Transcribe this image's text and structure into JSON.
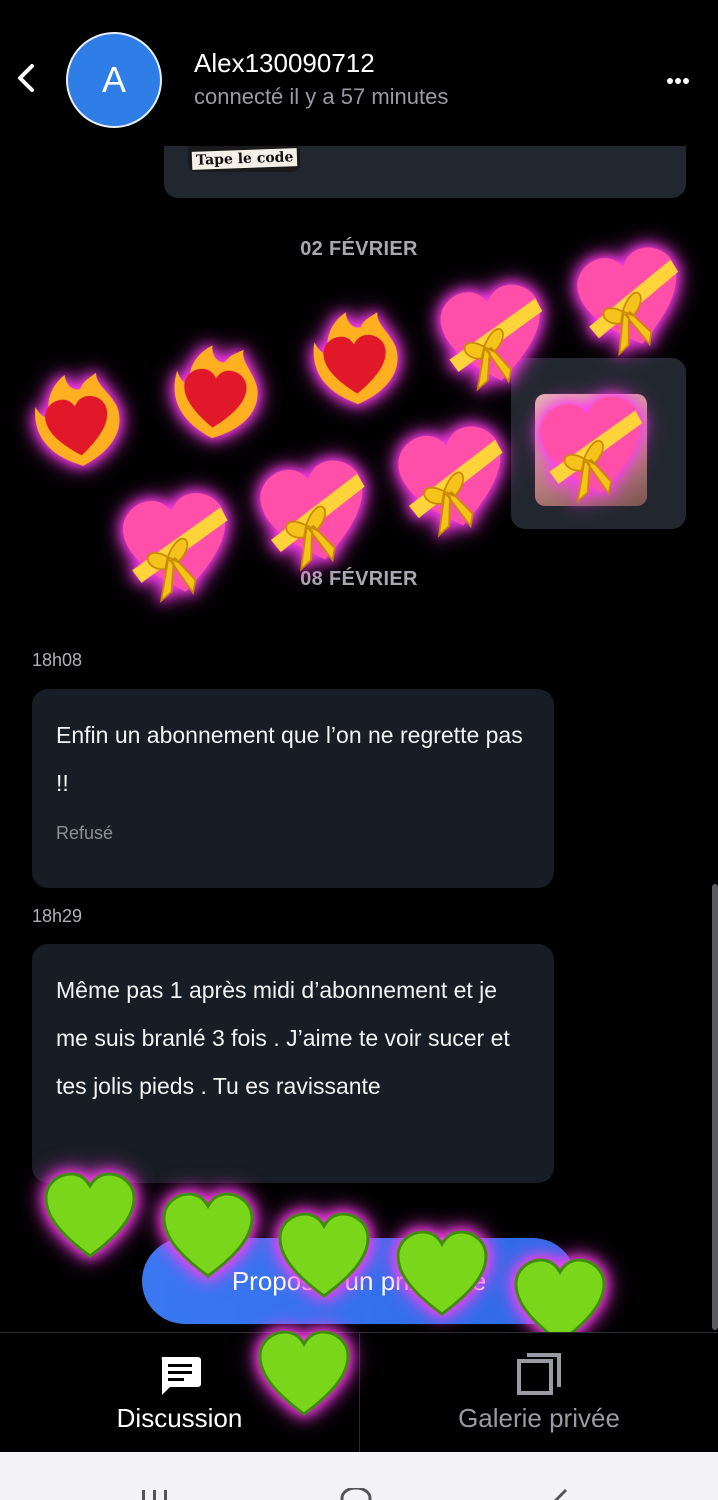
{
  "header": {
    "avatar_letter": "A",
    "contact_name": "Alex130090712",
    "contact_status": "connecté il y a 57 minutes"
  },
  "thread": {
    "previous_image_caption": "Tape le code",
    "date_separators": [
      "02 FÉVRIER",
      "08 FÉVRIER"
    ],
    "messages": [
      {
        "time": "18h08",
        "text": "Enfin un abonnement que l’on ne regrette pas !!",
        "status": "Refusé"
      },
      {
        "time": "18h29",
        "text": "Même pas 1 après midi d’abonnement et je me suis branlé 3 fois . J’aime te voir sucer et tes jolis pieds . Tu es ravissante",
        "status": ""
      }
    ],
    "propose_button_label": "Proposer un prix privé"
  },
  "stickers": {
    "fire_heart_icon": "heart-on-fire",
    "gift_heart_icon": "heart-with-ribbon",
    "green_heart_icon": "green-heart",
    "colors": {
      "glow": "#ff3cf0",
      "green": "#7ad61a",
      "pink": "#ff4fa8",
      "red": "#e0182a"
    }
  },
  "bottom_nav": {
    "items": [
      {
        "label": "Discussion",
        "icon": "chat-bubble-icon",
        "active": true
      },
      {
        "label": "Galerie privée",
        "icon": "gallery-icon",
        "active": false
      }
    ]
  },
  "colors": {
    "accent": "#2f7de6",
    "bubble": "#181c24",
    "background": "#000000"
  }
}
